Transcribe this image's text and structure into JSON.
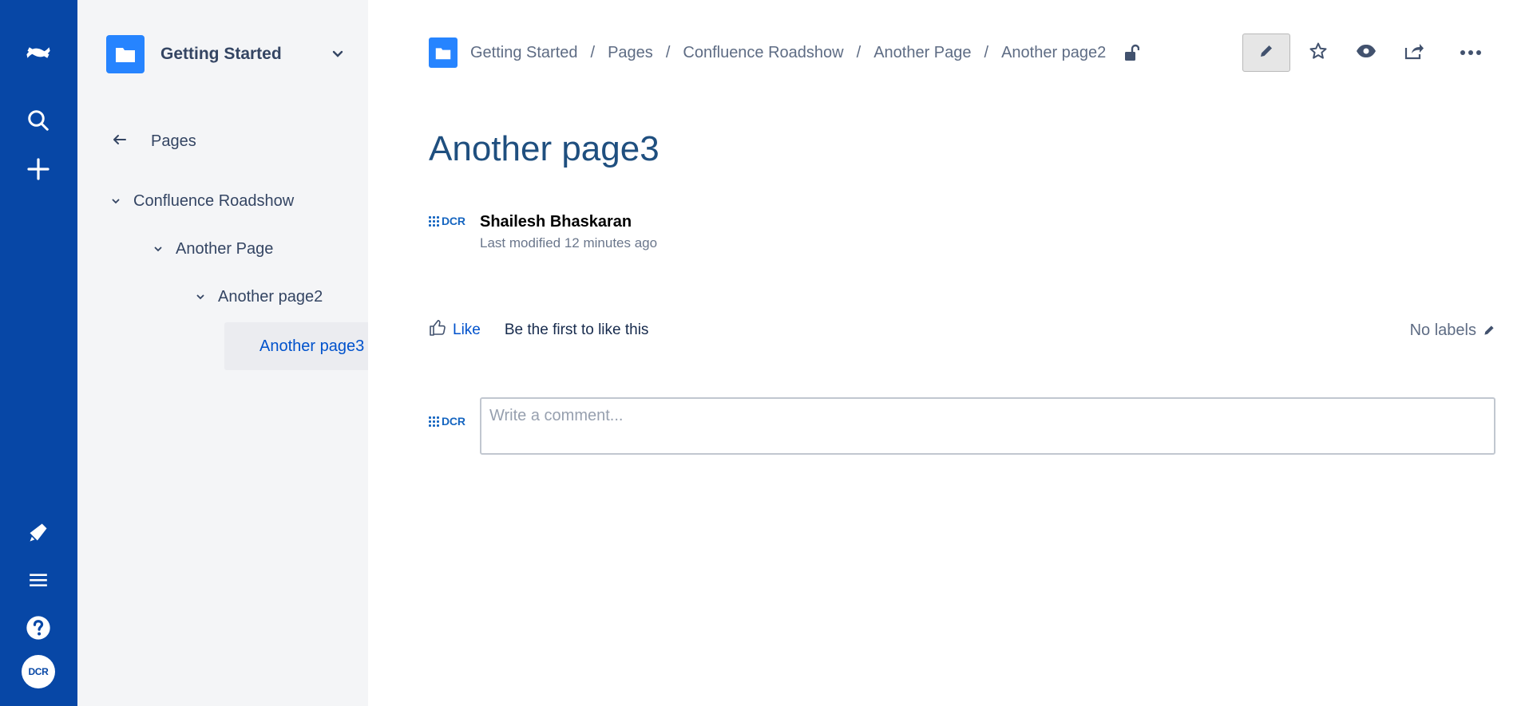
{
  "global_nav": {
    "avatar_text": "DCR",
    "accent_color": "#0747A6"
  },
  "sidebar": {
    "space_name": "Getting Started",
    "back_label": "Pages",
    "tree": [
      {
        "label": "Confluence Roadshow"
      },
      {
        "label": "Another Page"
      },
      {
        "label": "Another page2"
      }
    ],
    "selected": {
      "label": "Another page3"
    }
  },
  "breadcrumbs": [
    {
      "label": "Getting Started"
    },
    {
      "label": "Pages"
    },
    {
      "label": "Confluence Roadshow"
    },
    {
      "label": "Another Page"
    },
    {
      "label": "Another page2"
    }
  ],
  "breadcrumb_separator": "/",
  "page": {
    "title": "Another page3",
    "author_logo_text": "DCR",
    "author": "Shailesh Bhaskaran",
    "modified": "Last modified 12 minutes ago"
  },
  "likes": {
    "like_label": "Like",
    "like_text": "Be the first to like this",
    "labels_text": "No labels"
  },
  "comment": {
    "logo_text": "DCR",
    "placeholder": "Write a comment..."
  },
  "icons": [
    "confluence-logo-icon",
    "search-icon",
    "plus-icon",
    "megaphone-icon",
    "menu-icon",
    "help-icon",
    "folder-icon",
    "chevron-down-icon",
    "arrow-left-icon",
    "unlock-icon",
    "pencil-icon",
    "star-icon",
    "eye-icon",
    "share-icon",
    "more-icon",
    "thumbs-up-icon"
  ]
}
